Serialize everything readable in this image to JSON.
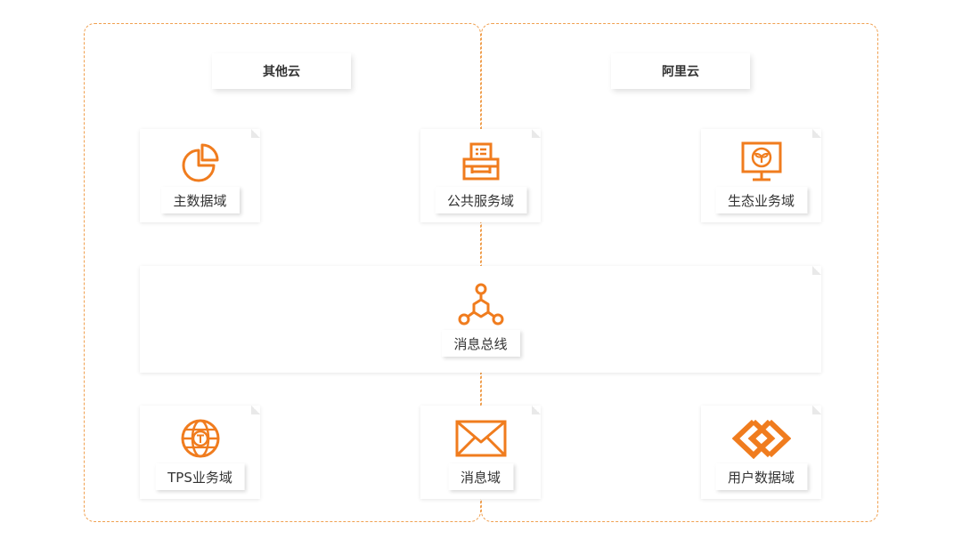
{
  "clouds": {
    "left_label": "其他云",
    "right_label": "阿里云"
  },
  "domains": {
    "master_data": "主数据域",
    "public_service": "公共服务域",
    "ecosystem": "生态业务域",
    "message_bus": "消息总线",
    "tps": "TPS业务域",
    "message": "消息域",
    "user_data": "用户数据域"
  },
  "icons": {
    "master_data": "pie-chart-icon",
    "public_service": "printer-icon",
    "ecosystem": "monitor-sprout-icon",
    "message_bus": "network-nodes-icon",
    "tps": "globe-icon",
    "message": "envelope-icon",
    "user_data": "linked-diamonds-icon"
  },
  "colors": {
    "accent": "#f07c1e",
    "region_border": "#f0a050"
  }
}
